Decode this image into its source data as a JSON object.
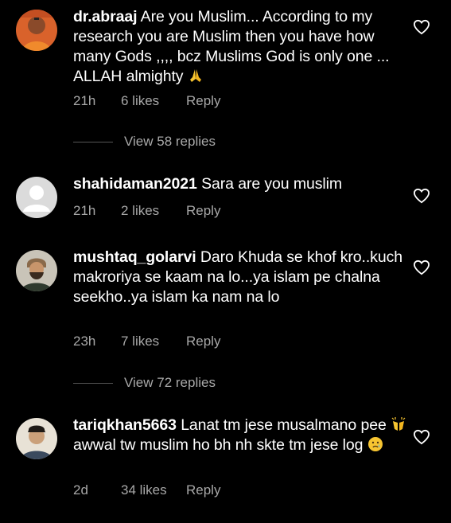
{
  "comments": [
    {
      "username": "dr.abraaj",
      "text": "Are you Muslim... According to my research you are Muslim then you have how many Gods ,,,, bcz Muslims God is only one ... ALLAH almighty",
      "emoji": "folded-hands",
      "time": "21h",
      "likes": "6 likes",
      "reply": "Reply",
      "view_replies": "View 58 replies"
    },
    {
      "username": "shahidaman2021",
      "text": "Sara are you muslim",
      "time": "21h",
      "likes": "2 likes",
      "reply": "Reply"
    },
    {
      "username": "mushtaq_golarvi",
      "text": "Daro Khuda se khof kro..kuch makroriya se kaam na lo...ya islam pe chalna seekho..ya islam ka nam na lo",
      "time": "23h",
      "likes": "7 likes",
      "reply": "Reply",
      "view_replies": "View 72 replies"
    },
    {
      "username": "tariqkhan5663",
      "text_before_emoji": "Lanat tm jese musalmano pee",
      "emoji_mid": "raising-hands",
      "text_after_emoji": "awwal tw muslim ho bh nh skte tm jese log",
      "emoji_end": "crying-face",
      "time": "2d",
      "likes": "34 likes",
      "reply": "Reply"
    }
  ],
  "colors": {
    "background": "#000000",
    "text": "#ffffff",
    "secondary": "#a8a8a8",
    "emoji_yellow": "#f7c531"
  }
}
